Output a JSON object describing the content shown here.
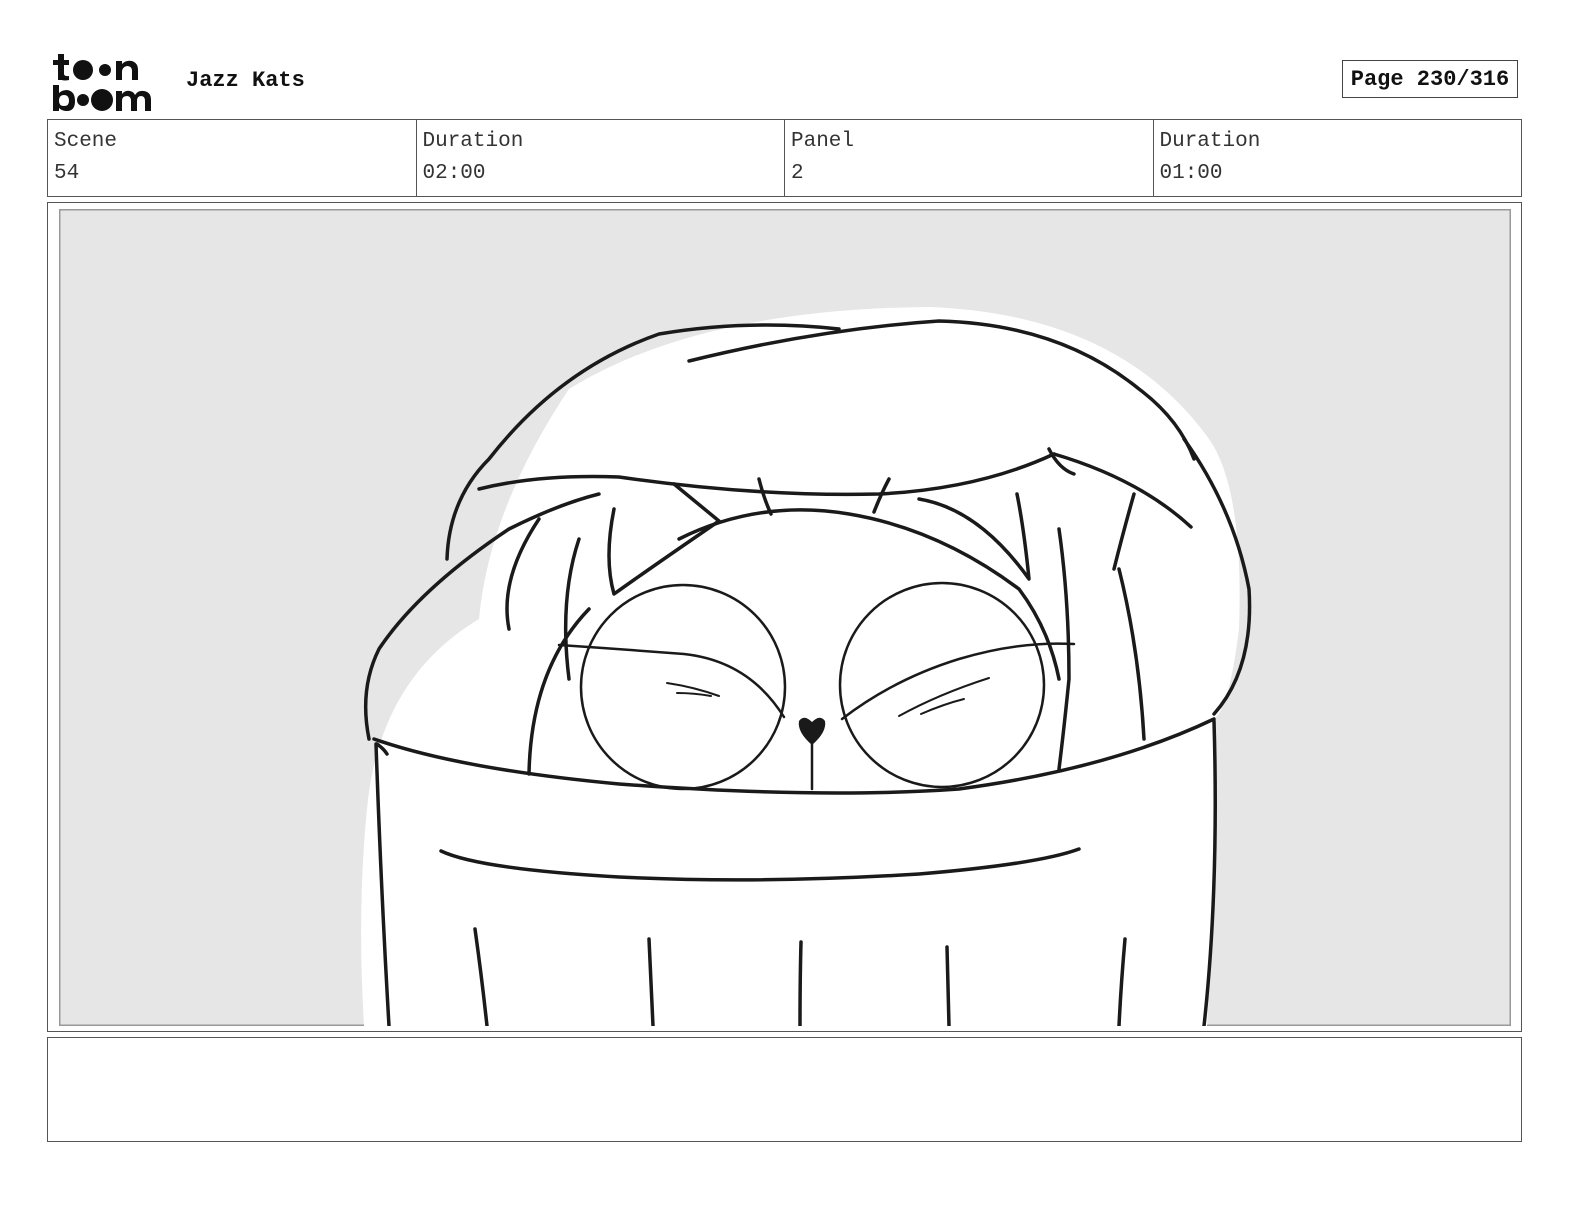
{
  "header": {
    "logo_text": "toon boom",
    "project_title": "Jazz Kats",
    "page_label": "Page 230/316"
  },
  "info": {
    "scene_label": "Scene",
    "scene_value": "54",
    "scene_duration_label": "Duration",
    "scene_duration_value": "02:00",
    "panel_label": "Panel",
    "panel_value": "2",
    "panel_duration_label": "Duration",
    "panel_duration_value": "01:00"
  },
  "notes": {
    "text": ""
  }
}
